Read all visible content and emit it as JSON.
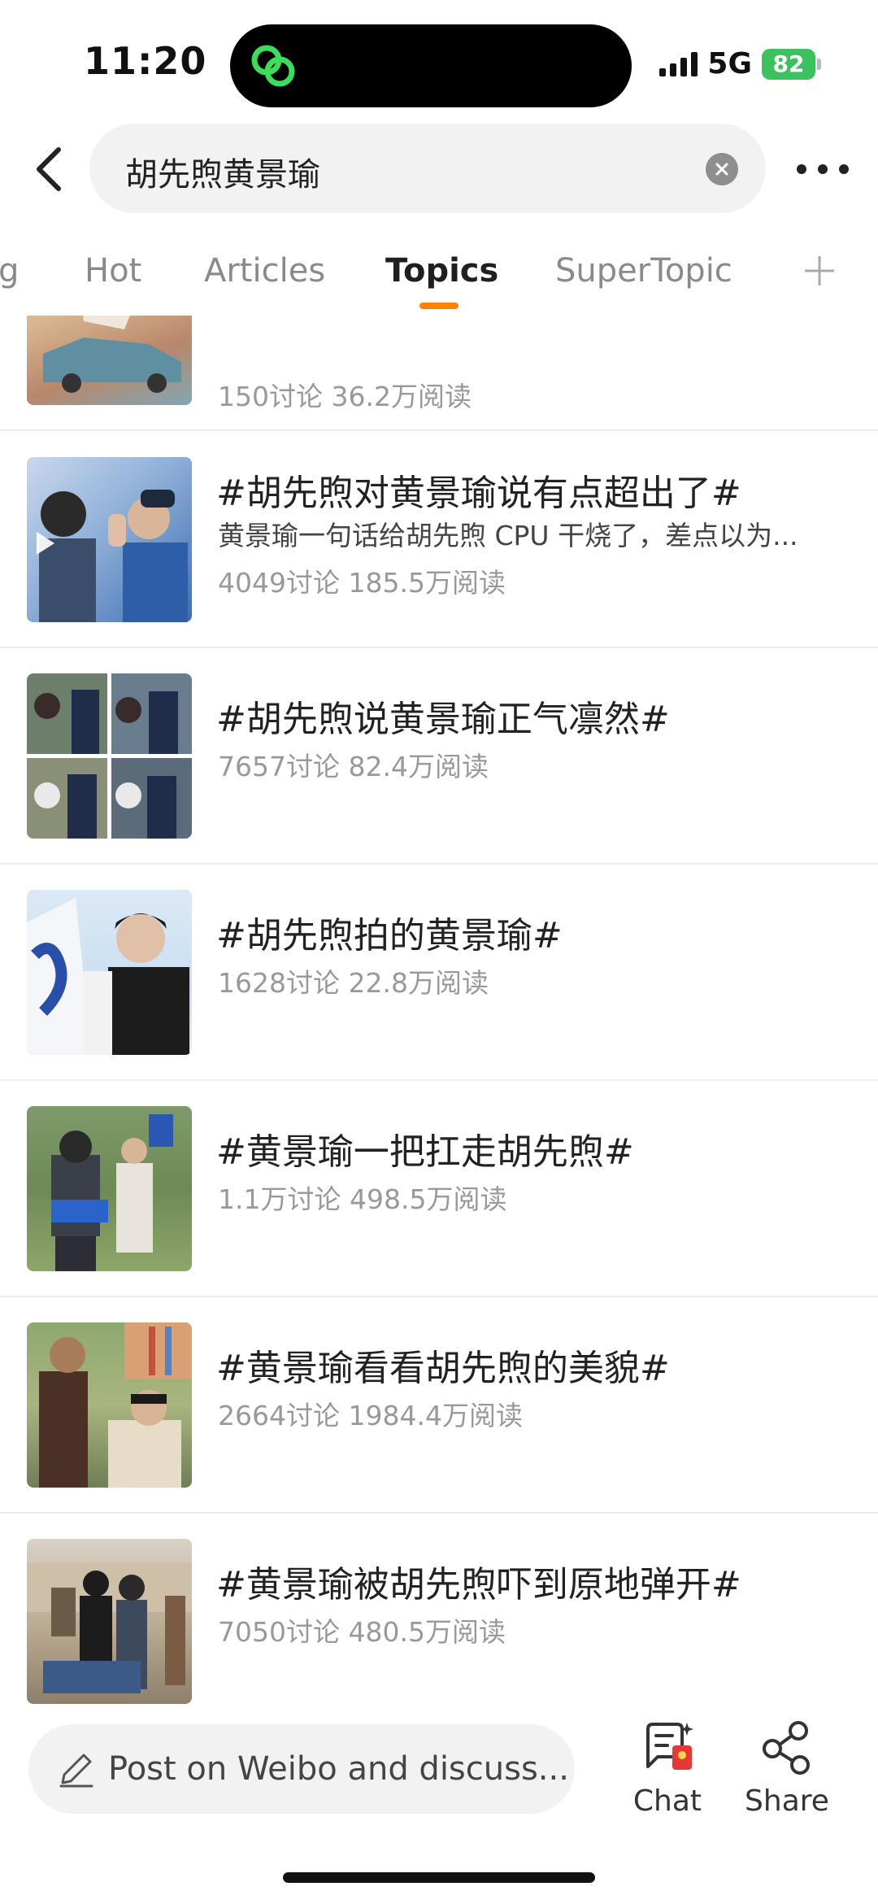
{
  "status_bar": {
    "time": "11:20",
    "network": "5G",
    "battery": "82"
  },
  "search": {
    "query": "胡先煦黄景瑜"
  },
  "tabs": [
    {
      "label": "g"
    },
    {
      "label": "Hot"
    },
    {
      "label": "Articles"
    },
    {
      "label": "Topics"
    },
    {
      "label": "SuperTopic"
    }
  ],
  "active_tab": "Topics",
  "topics": [
    {
      "title": "",
      "desc": "",
      "stats": "150讨论 36.2万阅读"
    },
    {
      "title": "#胡先煦对黄景瑜说有点超出了#",
      "desc": "黄景瑜一句话给胡先煦 CPU 干烧了，差点以为...",
      "stats": "4049讨论 185.5万阅读"
    },
    {
      "title": "#胡先煦说黄景瑜正气凛然#",
      "desc": "",
      "stats": "7657讨论 82.4万阅读"
    },
    {
      "title": "#胡先煦拍的黄景瑜#",
      "desc": "",
      "stats": "1628讨论 22.8万阅读"
    },
    {
      "title": "#黄景瑜一把扛走胡先煦#",
      "desc": "",
      "stats": "1.1万讨论 498.5万阅读"
    },
    {
      "title": "#黄景瑜看看胡先煦的美貌#",
      "desc": "",
      "stats": "2664讨论 1984.4万阅读"
    },
    {
      "title": "#黄景瑜被胡先煦吓到原地弹开#",
      "desc": "",
      "stats": "7050讨论 480.5万阅读"
    }
  ],
  "bottom_bar": {
    "compose_placeholder": "Post on Weibo and discuss...",
    "chat_label": "Chat",
    "share_label": "Share"
  },
  "colors": {
    "accent": "#ff8200",
    "battery": "#3cc060",
    "divider": "#ececec",
    "secondary_text": "#999999"
  },
  "icons": [
    "back-arrow-icon",
    "clear-icon",
    "more-icon",
    "add-tab-icon",
    "pencil-icon",
    "chat-icon",
    "share-icon",
    "play-icon",
    "signal-icon",
    "battery-icon"
  ]
}
